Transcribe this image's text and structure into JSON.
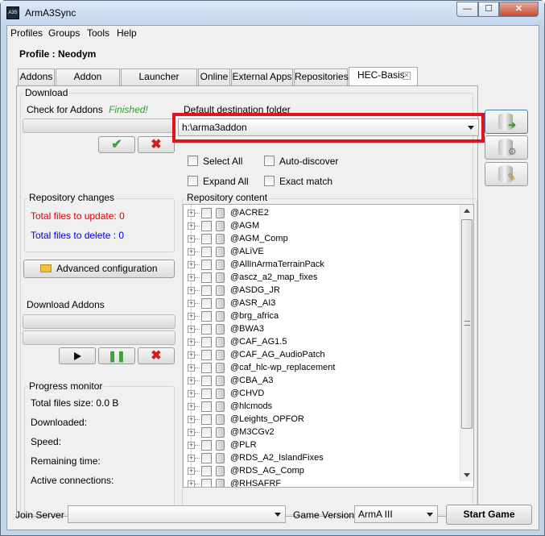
{
  "window": {
    "title": "ArmA3Sync",
    "app_icon": "arma3sync-logo-icon",
    "minimize": "—",
    "maximize": "☐",
    "close": "✕"
  },
  "menu": [
    "Profiles",
    "Groups",
    "Tools",
    "Help"
  ],
  "profile": {
    "label": "Profile : Neodym"
  },
  "tabs": [
    "Addons",
    "Addon Options",
    "Launcher Options",
    "Online",
    "External Apps",
    "Repositories",
    "HEC-Basis"
  ],
  "active_tab": "HEC-Basis",
  "download": {
    "group_label": "Download",
    "check_label": "Check for Addons",
    "check_status": "Finished!",
    "status_color": "#2e9e2e",
    "dest_label": "Default destination folder",
    "dest_value": "h:\\arma3addon",
    "select_all": "Select All",
    "auto_discover": "Auto-discover",
    "expand_all": "Expand All",
    "exact_match": "Exact match"
  },
  "repo_changes": {
    "label": "Repository changes",
    "to_update": "Total files to update: 0",
    "to_delete": "Total files to delete : 0",
    "update_color": "#e00000",
    "delete_color": "#0000dd"
  },
  "advanced_config": "Advanced configuration",
  "download_addons": {
    "label": "Download Addons"
  },
  "progress_monitor": {
    "label": "Progress monitor",
    "total_size": "Total files size: 0.0 B",
    "downloaded": "Downloaded:",
    "speed": "Speed:",
    "remaining": "Remaining time:",
    "connections": "Active connections:"
  },
  "repo_content": {
    "label": "Repository content",
    "items": [
      "@ACRE2",
      "@AGM",
      "@AGM_Comp",
      "@ALiVE",
      "@AllInArmaTerrainPack",
      "@ascz_a2_map_fixes",
      "@ASDG_JR",
      "@ASR_AI3",
      "@brg_africa",
      "@BWA3",
      "@CAF_AG1.5",
      "@CAF_AG_AudioPatch",
      "@caf_hlc-wp_replacement",
      "@CBA_A3",
      "@CHVD",
      "@hlcmods",
      "@Leights_OPFOR",
      "@M3CGv2",
      "@PLR",
      "@RDS_A2_IslandFixes",
      "@RDS_AG_Comp",
      "@RHSAFRF"
    ]
  },
  "bottom": {
    "join_server_label": "Join Server",
    "join_server_value": "",
    "game_version_label": "Game Version",
    "game_version_value": "ArmA III",
    "start_game": "Start Game"
  },
  "colors": {
    "highlight": "#e0141e",
    "accent": "#c2d6ea"
  }
}
